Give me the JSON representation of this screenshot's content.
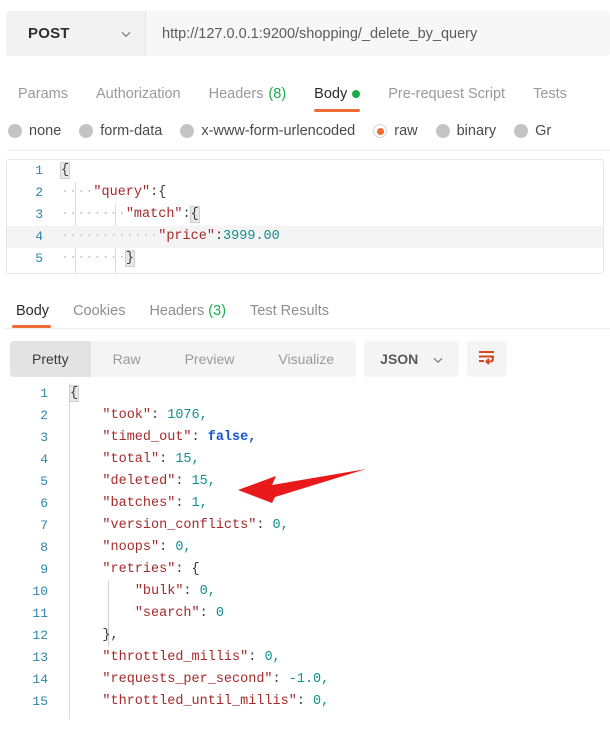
{
  "request": {
    "method": "POST",
    "url": "http://127.0.0.1:9200/shopping/_delete_by_query",
    "tabs": [
      {
        "label": "Params",
        "active": false,
        "badge": ""
      },
      {
        "label": "Authorization",
        "active": false,
        "badge": ""
      },
      {
        "label": "Headers",
        "active": false,
        "badge": "(8)"
      },
      {
        "label": "Body",
        "active": true,
        "badge": ""
      },
      {
        "label": "Pre-request Script",
        "active": false,
        "badge": ""
      },
      {
        "label": "Tests",
        "active": false,
        "badge": ""
      }
    ],
    "body_types": [
      {
        "label": "none",
        "selected": false
      },
      {
        "label": "form-data",
        "selected": false
      },
      {
        "label": "x-www-form-urlencoded",
        "selected": false
      },
      {
        "label": "raw",
        "selected": true
      },
      {
        "label": "binary",
        "selected": false
      },
      {
        "label": "Gr",
        "selected": false
      }
    ],
    "body_lines": [
      {
        "n": "1",
        "content": "{"
      },
      {
        "n": "2",
        "content": "    \"query\":{"
      },
      {
        "n": "3",
        "content": "        \"match\":{"
      },
      {
        "n": "4",
        "content": "            \"price\":3999.00"
      },
      {
        "n": "5",
        "content": "        }"
      }
    ]
  },
  "response": {
    "tabs": [
      {
        "label": "Body",
        "active": true,
        "badge": ""
      },
      {
        "label": "Cookies",
        "active": false,
        "badge": ""
      },
      {
        "label": "Headers",
        "active": false,
        "badge": "(3)"
      },
      {
        "label": "Test Results",
        "active": false,
        "badge": ""
      }
    ],
    "format_tabs": [
      {
        "label": "Pretty",
        "active": true
      },
      {
        "label": "Raw",
        "active": false
      },
      {
        "label": "Preview",
        "active": false
      },
      {
        "label": "Visualize",
        "active": false
      }
    ],
    "language": "JSON",
    "wrap_icon": "word-wrap-icon",
    "body_lines": [
      {
        "n": "1",
        "key": "",
        "value": "{"
      },
      {
        "n": "2",
        "key": "\"took\"",
        "value": "1076,"
      },
      {
        "n": "3",
        "key": "\"timed_out\"",
        "value": "false,"
      },
      {
        "n": "4",
        "key": "\"total\"",
        "value": "15,"
      },
      {
        "n": "5",
        "key": "\"deleted\"",
        "value": "15,"
      },
      {
        "n": "6",
        "key": "\"batches\"",
        "value": "1,"
      },
      {
        "n": "7",
        "key": "\"version_conflicts\"",
        "value": "0,"
      },
      {
        "n": "8",
        "key": "\"noops\"",
        "value": "0,"
      },
      {
        "n": "9",
        "key": "\"retries\"",
        "value": "{"
      },
      {
        "n": "10",
        "key": "\"bulk\"",
        "value": "0,"
      },
      {
        "n": "11",
        "key": "\"search\"",
        "value": "0"
      },
      {
        "n": "12",
        "key": "",
        "value": "},"
      },
      {
        "n": "13",
        "key": "\"throttled_millis\"",
        "value": "0,"
      },
      {
        "n": "14",
        "key": "\"requests_per_second\"",
        "value": "-1.0,"
      },
      {
        "n": "15",
        "key": "\"throttled_until_millis\"",
        "value": "0,"
      }
    ]
  },
  "annotation": {
    "type": "arrow",
    "color": "#e8191b",
    "points_at": "deleted-value-line-5"
  },
  "colors": {
    "accent": "#ef6c35",
    "badge_green": "#1bab4b",
    "json_key": "#a52a2a",
    "json_number": "#0f8f8f",
    "json_bool": "#1a53c9",
    "line_number": "#2e86ab"
  }
}
